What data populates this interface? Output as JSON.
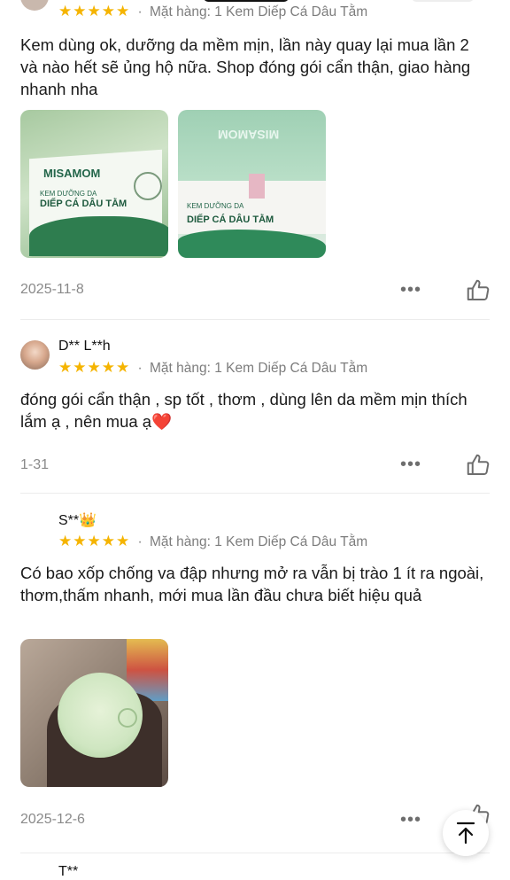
{
  "reviews": [
    {
      "item_label": "Mặt hàng: 1 Kem Diếp Cá Dâu Tằm",
      "text": "Kem dùng ok, dưỡng da mềm mịn, lần này quay lại mua lần 2 và nào hết sẽ ủng hộ nữa. Shop đóng gói cẩn thận, giao hàng nhanh nha",
      "photos": [
        {
          "brand": "MISAMOM",
          "line1": "KEM DƯỠNG DA",
          "line2": "DIẾP CÁ DÂU TẰM"
        },
        {
          "brand": "MISAMOM",
          "line1": "KEM DƯỠNG DA",
          "line2": "DIẾP CÁ DÂU TẰM"
        }
      ],
      "date": "2025-11-8"
    },
    {
      "username": "D** L**h",
      "item_label": "Mặt hàng: 1 Kem Diếp Cá Dâu Tằm",
      "text": "đóng gói cẩn thận , sp tốt , thơm , dùng lên da mềm mịn thích lắm ạ , nên mua ạ❤️",
      "date": "1-31"
    },
    {
      "username": "S**👑",
      "item_label": "Mặt hàng: 1 Kem Diếp Cá Dâu Tằm",
      "text": "Có bao xốp chống va đập nhưng mở ra vẫn bị trào 1 ít ra ngoài, thơm,thấm nhanh, mới mua lần đầu chưa biết hiệu quả",
      "date": "2025-12-6"
    },
    {
      "username": "T**"
    }
  ],
  "rating_stars": "★★★★★",
  "separator": "·",
  "more_label": "•••",
  "colors": {
    "star": "#f5b400",
    "text": "#1a1a1a",
    "muted": "#8a8a8a"
  }
}
